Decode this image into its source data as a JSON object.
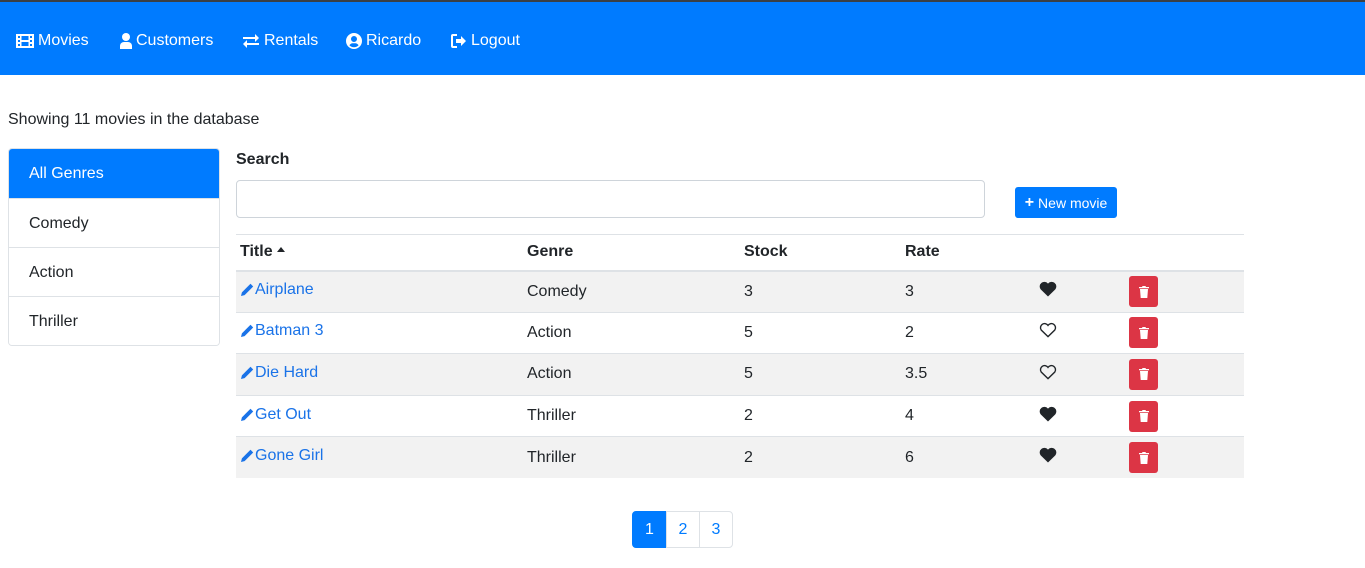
{
  "colors": {
    "primary": "#007bff",
    "danger": "#dc3545",
    "link": "#1a73e8",
    "stripe": "#f2f2f2"
  },
  "nav": {
    "items": [
      {
        "label": "Movies",
        "icon": "film-icon"
      },
      {
        "label": "Customers",
        "icon": "user-icon"
      },
      {
        "label": "Rentals",
        "icon": "exchange-icon"
      },
      {
        "label": "Ricardo",
        "icon": "user-circle-icon"
      },
      {
        "label": "Logout",
        "icon": "sign-out-icon"
      }
    ]
  },
  "summary": "Showing 11 movies in the database",
  "genres": {
    "items": [
      "All Genres",
      "Comedy",
      "Action",
      "Thriller"
    ],
    "selected": "All Genres"
  },
  "search": {
    "label": "Search",
    "value": "",
    "placeholder": ""
  },
  "new_movie_button": {
    "label": "New movie",
    "icon": "plus-icon"
  },
  "table": {
    "columns": [
      "Title",
      "Genre",
      "Stock",
      "Rate"
    ],
    "sort": {
      "column": "Title",
      "direction": "asc"
    },
    "rows": [
      {
        "title": "Airplane",
        "genre": "Comedy",
        "stock": "3",
        "rate": "3",
        "liked": true
      },
      {
        "title": "Batman 3",
        "genre": "Action",
        "stock": "5",
        "rate": "2",
        "liked": false
      },
      {
        "title": "Die Hard",
        "genre": "Action",
        "stock": "5",
        "rate": "3.5",
        "liked": false
      },
      {
        "title": "Get Out",
        "genre": "Thriller",
        "stock": "2",
        "rate": "4",
        "liked": true
      },
      {
        "title": "Gone Girl",
        "genre": "Thriller",
        "stock": "2",
        "rate": "6",
        "liked": true
      }
    ]
  },
  "pagination": {
    "pages": [
      "1",
      "2",
      "3"
    ],
    "current": "1"
  }
}
